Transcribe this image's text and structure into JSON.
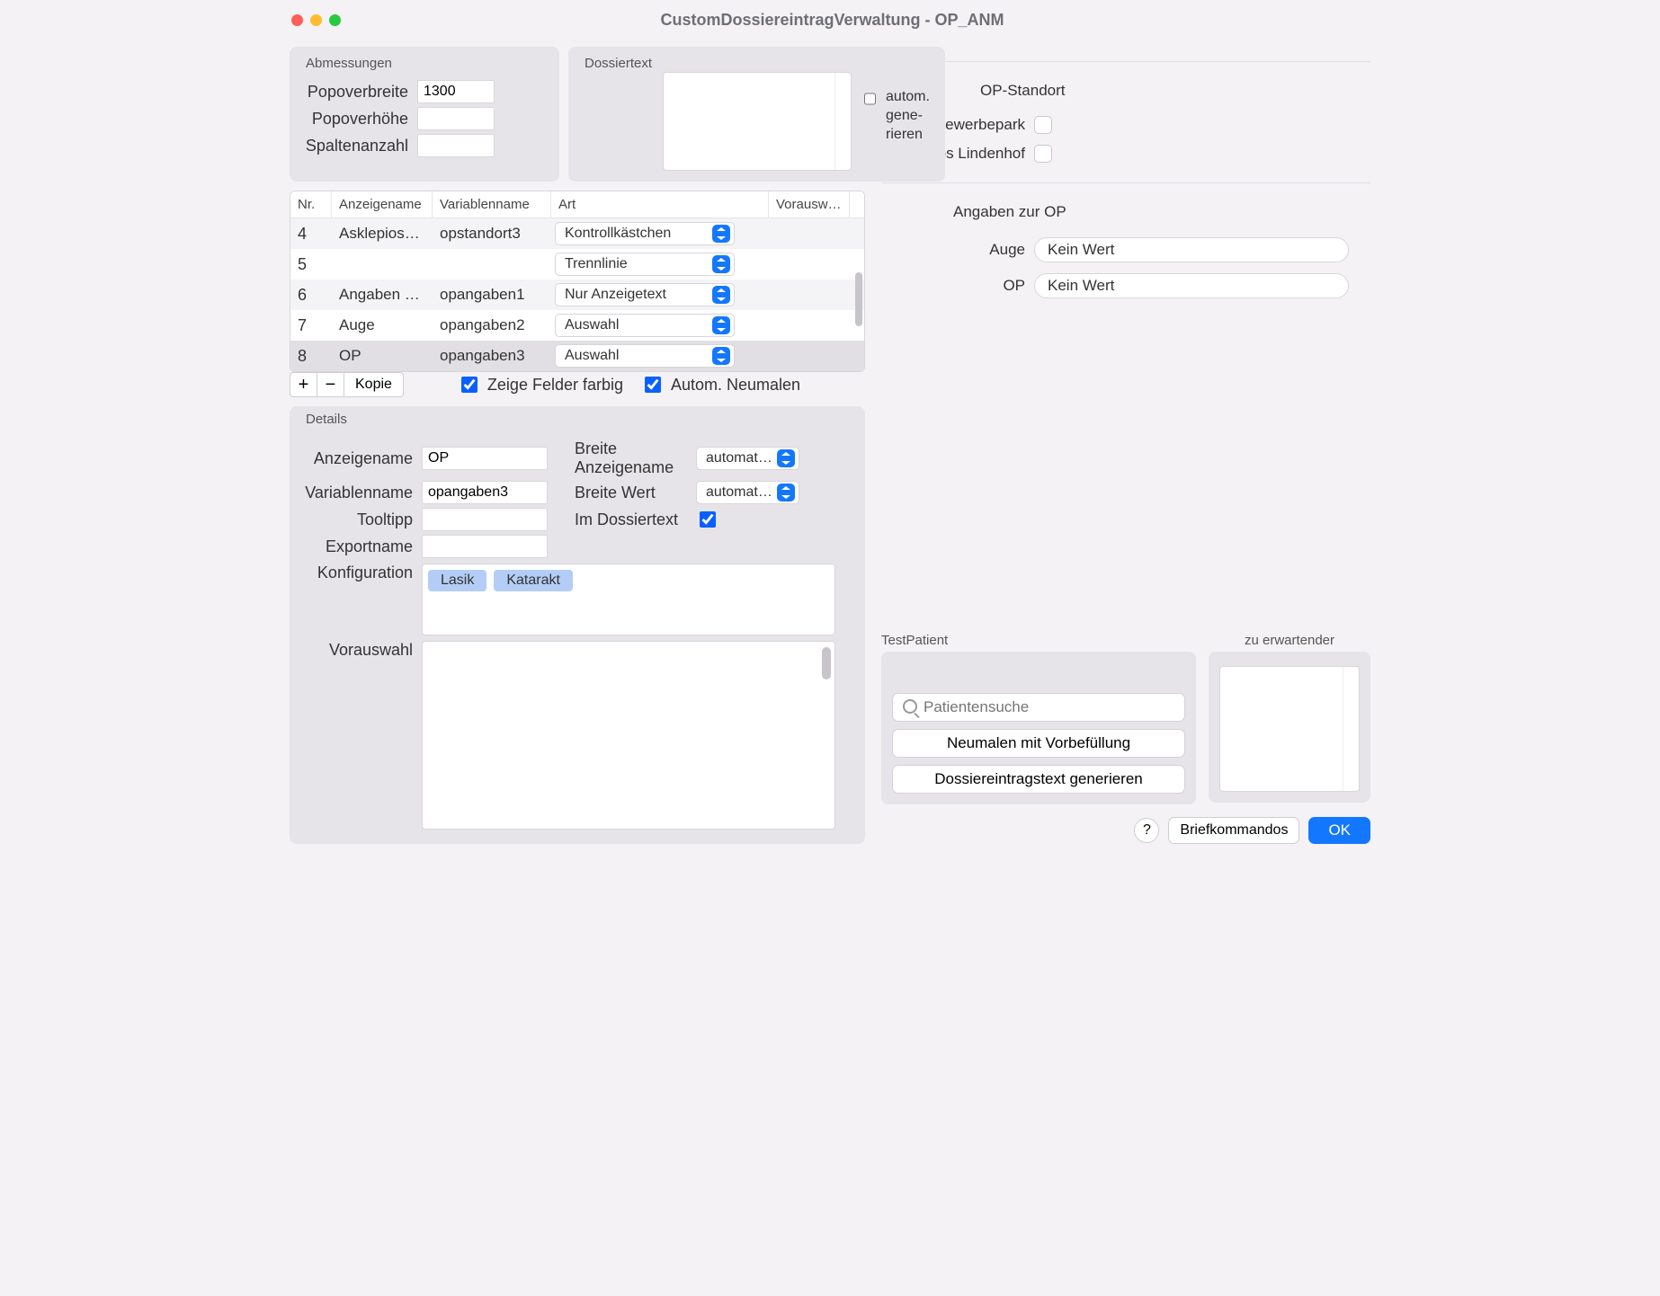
{
  "window_title": "CustomDossiereintragVerwaltung - OP_ANM",
  "abm": {
    "title": "Abmessungen",
    "popoverbreite_label": "Popoverbreite",
    "popoverbreite_value": "1300",
    "popoverhoehe_label": "Popoverhöhe",
    "popoverhoehe_value": "",
    "spaltenanzahl_label": "Spaltenanzahl",
    "spaltenanzahl_value": ""
  },
  "dossier": {
    "title": "Dossiertext",
    "autogen_label": "autom. gene­rieren"
  },
  "table": {
    "headers": {
      "nr": "Nr.",
      "an": "Anzeigename",
      "vn": "Variablenname",
      "art": "Art",
      "vw": "Vorausw…"
    },
    "rows": [
      {
        "nr": "4",
        "an": "Asklepios…",
        "vn": "opstandort3",
        "art": "Kontrollkästchen",
        "sel": false
      },
      {
        "nr": "5",
        "an": "",
        "vn": "",
        "art": "Trennlinie",
        "sel": false
      },
      {
        "nr": "6",
        "an": "Angaben z…",
        "vn": "opangaben1",
        "art": "Nur Anzeigetext",
        "sel": false
      },
      {
        "nr": "7",
        "an": "Auge",
        "vn": "opangaben2",
        "art": "Auswahl",
        "sel": false
      },
      {
        "nr": "8",
        "an": "OP",
        "vn": "opangaben3",
        "art": "Auswahl",
        "sel": true
      }
    ],
    "buttons": {
      "add": "+",
      "remove": "−",
      "kopie": "Kopie"
    },
    "show_fields_label": "Zeige Felder farbig",
    "auto_redraw_label": "Autom. Neumalen"
  },
  "details": {
    "title": "Details",
    "anzeigename_label": "Anzeigename",
    "anzeigename_value": "OP",
    "variablenname_label": "Variablenname",
    "variablenname_value": "opangaben3",
    "tooltipp_label": "Tooltipp",
    "tooltipp_value": "",
    "exportname_label": "Exportname",
    "exportname_value": "",
    "breite_an_label": "Breite Anzeigename",
    "breite_an_value": "automat…",
    "breite_wert_label": "Breite Wert",
    "breite_wert_value": "automat…",
    "im_dossiertext_label": "Im Dossiertext",
    "konfiguration_label": "Konfiguration",
    "chips": [
      "Lasik",
      "Katarakt"
    ],
    "vorauswahl_label": "Vorauswahl"
  },
  "right": {
    "op_standort_title": "OP-Standort",
    "gewerbepark_label": "Gewerbepark",
    "asklepios_label": "Asklepios Lindenhof",
    "angaben_title": "Angaben zur OP",
    "auge_label": "Auge",
    "auge_value": "Kein Wert",
    "op_label": "OP",
    "op_value": "Kein Wert"
  },
  "testpatient": {
    "title": "TestPatient",
    "search_placeholder": "Patientensuche",
    "btn_neumalen": "Neumalen mit Vorbefüllung",
    "btn_generate": "Dossiereintragstext generieren"
  },
  "expected": {
    "title": "zu erwartender"
  },
  "footer": {
    "help": "?",
    "brief": "Briefkommandos",
    "ok": "OK"
  }
}
